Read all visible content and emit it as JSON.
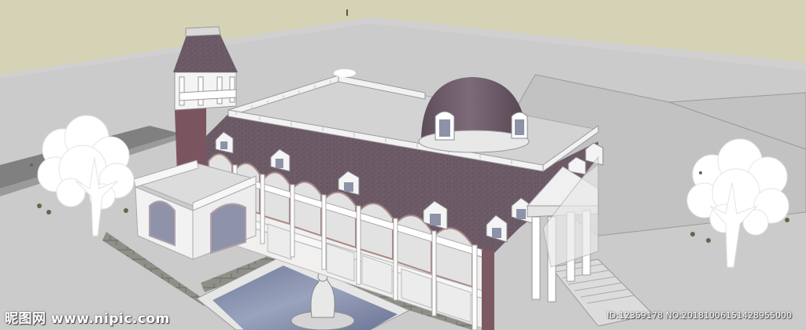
{
  "watermark": {
    "site": "昵图网 www.nipic.com",
    "id_text": "ID:12359178 NO:20181006151428955000"
  },
  "colors": {
    "sky": "#d6d2b6",
    "ground": "#c9c9c9",
    "ground_dark": "#9d9d9d",
    "road": "#7a7a7a",
    "roof": "#6b5a66",
    "roof_light": "#8b7786",
    "wall": "#f1f0ee",
    "brick": "#7a5560",
    "stone": "#8c8c86",
    "water": "#7e88a6",
    "tree": "#ffffff"
  }
}
